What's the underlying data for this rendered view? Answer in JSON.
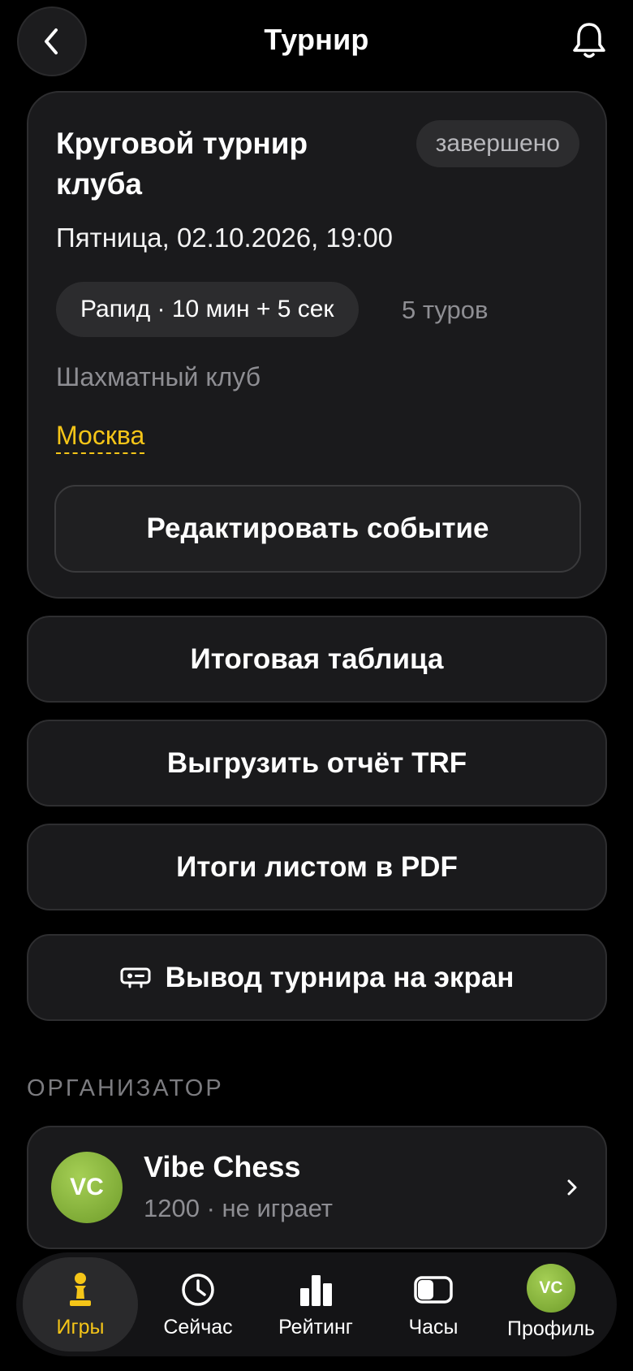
{
  "header": {
    "title": "Турнир",
    "back_icon": "chevron-left-icon",
    "bell_icon": "bell-icon"
  },
  "event": {
    "title": "Круговой турнир клуба",
    "status": "завершено",
    "date": "Пятница, 02.10.2026, 19:00",
    "format": "Рапид · 10 мин + 5 сек",
    "rounds": "5 туров",
    "club": "Шахматный клуб",
    "city": "Москва",
    "edit_label": "Редактировать событие"
  },
  "actions": {
    "standings": "Итоговая таблица",
    "trf_export": "Выгрузить отчёт TRF",
    "pdf_results": "Итоги листом в PDF",
    "screen_output": "Вывод турнира на экран"
  },
  "organizer": {
    "section_label": "ОРГАНИЗАТОР",
    "avatar_initials": "VC",
    "name": "Vibe Chess",
    "subtitle": "1200 · не играет"
  },
  "nav": {
    "items": [
      {
        "label": "Игры",
        "icon": "pawn-icon",
        "active": true
      },
      {
        "label": "Сейчас",
        "icon": "clock-icon",
        "active": false
      },
      {
        "label": "Рейтинг",
        "icon": "bar-chart-icon",
        "active": false
      },
      {
        "label": "Часы",
        "icon": "toggle-clock-icon",
        "active": false
      },
      {
        "label": "Профиль",
        "icon": "avatar",
        "active": false,
        "initials": "VC"
      }
    ]
  },
  "colors": {
    "accent": "#f5c518",
    "card_bg": "#1a1a1c",
    "avatar_green": "#8dbb3f"
  }
}
